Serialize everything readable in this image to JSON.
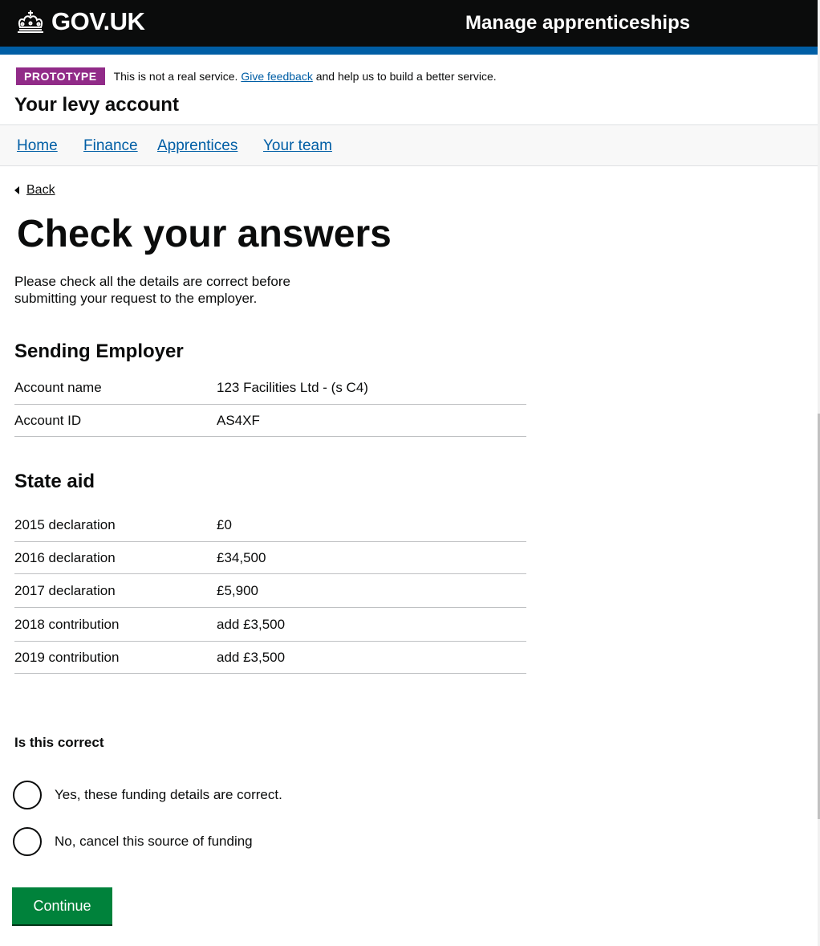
{
  "header": {
    "logo_text": "GOV.UK",
    "service_name": "Manage apprenticeships"
  },
  "phase_banner": {
    "tag": "PROTOTYPE",
    "text_before": "This is not a real service. ",
    "link": "Give feedback",
    "text_after": " and help us to build a better service."
  },
  "account_title": "Your levy account",
  "nav": {
    "items": [
      {
        "label": "Home"
      },
      {
        "label": "Finance"
      },
      {
        "label": "Apprentices"
      },
      {
        "label": "Your team"
      }
    ]
  },
  "back_label": "Back",
  "page_heading": "Check your answers",
  "intro": "Please check all the details are correct before submitting your request to the employer.",
  "sending_employer": {
    "heading": "Sending Employer",
    "rows": [
      {
        "key": "Account name",
        "value": "123 Facilities Ltd - (s C4)"
      },
      {
        "key": "Account ID",
        "value": "AS4XF"
      }
    ]
  },
  "state_aid": {
    "heading": "State aid",
    "rows": [
      {
        "key": "2015 declaration",
        "value": "£0"
      },
      {
        "key": "2016 declaration",
        "value": "£34,500"
      },
      {
        "key": "2017 declaration",
        "value": "£5,900"
      },
      {
        "key": "2018 contribution",
        "value": "add £3,500"
      },
      {
        "key": "2019 contribution",
        "value": "add £3,500"
      }
    ]
  },
  "question": {
    "label": "Is this correct",
    "options": [
      {
        "label": "Yes, these funding details are correct."
      },
      {
        "label": "No, cancel this source of funding"
      }
    ]
  },
  "continue_label": "Continue",
  "colors": {
    "header_bg": "#0b0c0c",
    "header_border": "#005ea5",
    "phase_tag_bg": "#912b88",
    "link": "#005ea5",
    "button_bg": "#00823b"
  }
}
